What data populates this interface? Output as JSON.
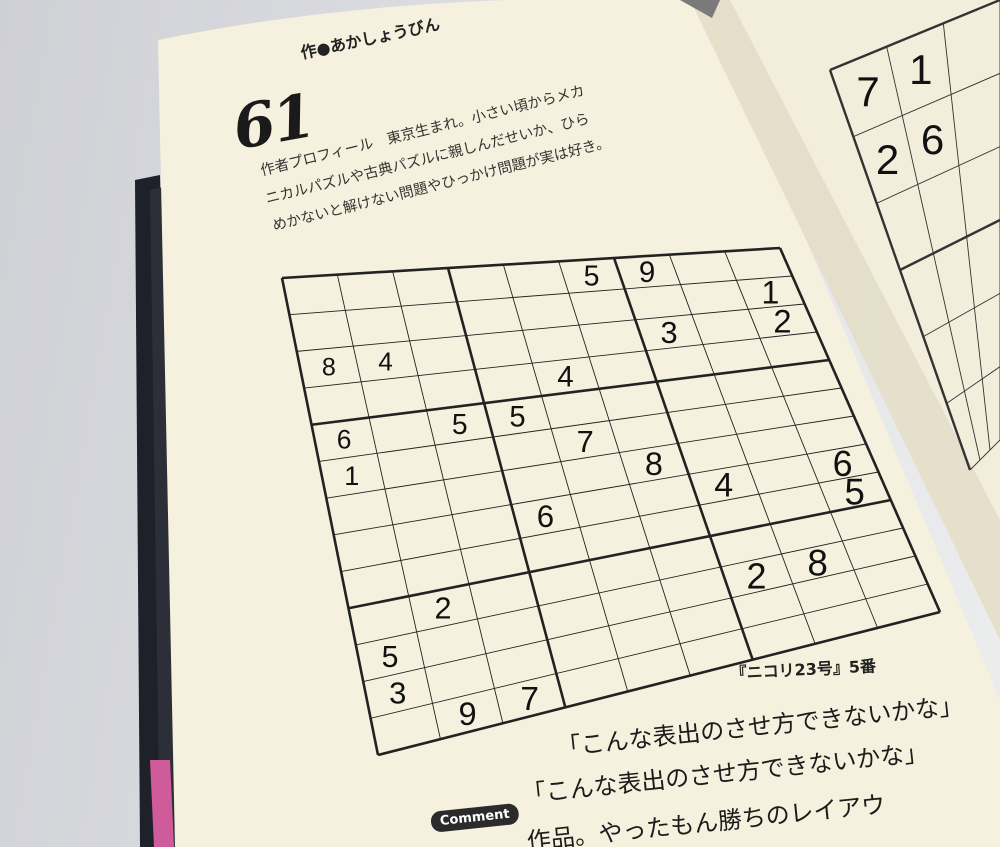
{
  "puzzle": {
    "number": "61",
    "author": "作●あかしょうびん",
    "profile_lines": [
      "作者プロフィール　東京生まれ。小さい頃からメカ",
      "ニカルパズルや古典パズルに親しんだせいか、ひら",
      "めかないと解けない問題やひっかけ問題が実は好き。"
    ],
    "source": "『ニコリ23号』5番",
    "comment_badge": "Comment",
    "comment_lines": [
      "「こんな表出のさせ方できないかな」",
      "「こんな表出のさせ方できないかな」",
      "作品。やったもん勝ちのレイアウ"
    ],
    "grid": [
      [
        0,
        0,
        0,
        0,
        0,
        5,
        9,
        0,
        0
      ],
      [
        0,
        0,
        0,
        0,
        0,
        0,
        0,
        0,
        1
      ],
      [
        8,
        4,
        0,
        0,
        0,
        0,
        3,
        0,
        2
      ],
      [
        0,
        0,
        0,
        0,
        4,
        0,
        0,
        0,
        0
      ],
      [
        6,
        0,
        5,
        5,
        0,
        0,
        0,
        0,
        0
      ],
      [
        1,
        0,
        0,
        0,
        7,
        0,
        0,
        0,
        0
      ],
      [
        0,
        0,
        0,
        0,
        0,
        8,
        0,
        0,
        0
      ],
      [
        0,
        0,
        0,
        6,
        0,
        0,
        4,
        0,
        6
      ],
      [
        0,
        0,
        0,
        0,
        0,
        0,
        0,
        0,
        5
      ],
      [
        0,
        2,
        0,
        0,
        0,
        0,
        0,
        0,
        0
      ],
      [
        5,
        0,
        0,
        0,
        0,
        0,
        2,
        8,
        0
      ],
      [
        3,
        0,
        0,
        0,
        0,
        0,
        0,
        0,
        0
      ],
      [
        0,
        9,
        7,
        0,
        0,
        0,
        0,
        0,
        0
      ]
    ]
  },
  "right_page": {
    "digits": [
      "7",
      "1",
      "2",
      "6"
    ]
  },
  "colors": {
    "paper": "#f6f1de",
    "ink": "#111111",
    "spine": "#1e2129",
    "bookmark": "#cf5b9a"
  }
}
